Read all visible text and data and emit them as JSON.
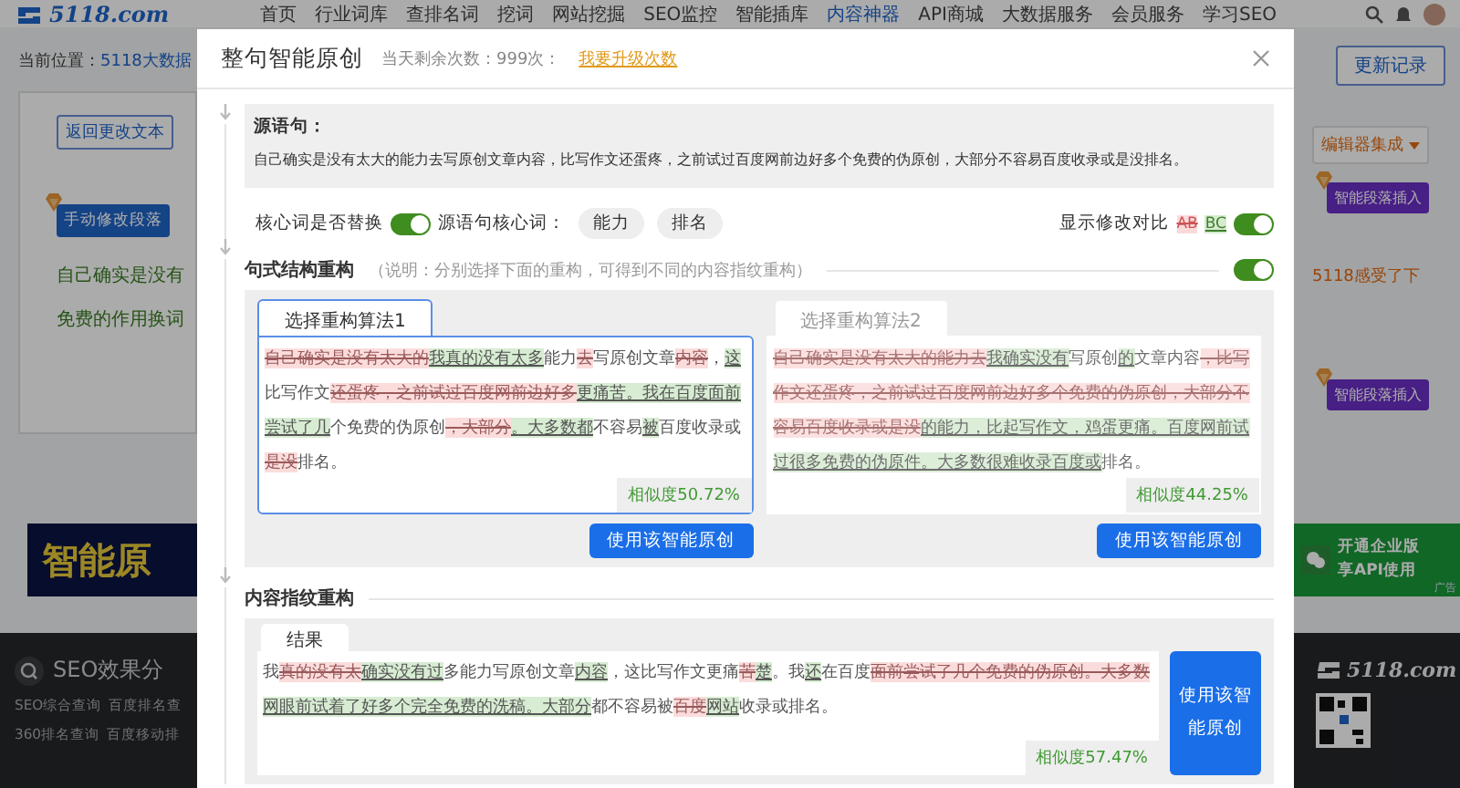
{
  "nav": {
    "logo": "5118.com",
    "items": [
      "首页",
      "行业词库",
      "查排名词",
      "挖词",
      "网站挖掘",
      "SEO监控",
      "智能插库",
      "内容神器",
      "API商城",
      "大数据服务",
      "会员服务",
      "学习SEO"
    ]
  },
  "background": {
    "breadcrumb_label": "当前位置：",
    "breadcrumb_link": "5118大数据",
    "back_button": "返回更改文本",
    "manual_button": "手动修改段落",
    "preview_lines": [
      "自己确实是没有",
      "免费的作用换词"
    ],
    "banner_left": "智能原",
    "footer_title": "SEO效果分",
    "footer_links": [
      "SEO综合查询",
      "百度排名查",
      "360排名查询",
      "百度移动排"
    ],
    "update_button": "更新记录",
    "editor_button": "编辑器集成",
    "insert_buttons": [
      "智能段落插入",
      "智能段落插入"
    ],
    "right_preview": "5118感受了下",
    "banner_right": [
      "开通企业版",
      "享API使用"
    ],
    "ad_label": "广告",
    "footer_logo": "5118.com"
  },
  "modal": {
    "title": "整句智能原创",
    "quota": "当天剩余次数：999次：",
    "upgrade_link": "我要升级次数",
    "source": {
      "heading": "源语句：",
      "text": "自己确实是没有太大的能力去写原创文章内容，比写作文还蛋疼，之前试过百度网前边好多个免费的伪原创，大部分不容易百度收录或是没排名。"
    },
    "options": {
      "replace_label": "核心词是否替换",
      "replace_on": true,
      "keywords_label": "源语句核心词：",
      "keywords": [
        "能力",
        "排名"
      ],
      "compare_label": "显示修改对比",
      "compare_removed": "AB",
      "compare_added": "BC",
      "compare_on": true
    },
    "restructure": {
      "title": "句式结构重构",
      "note": "（说明：分别选择下面的重构，可得到不同的内容指纹重构）",
      "on": true,
      "methods": [
        {
          "tab": "选择重构算法1",
          "selected": true,
          "similarity": "相似度50.72%",
          "button": "使用该智能原创",
          "segments": [
            {
              "kind": "del",
              "text": "自己确实是没有太大的"
            },
            {
              "kind": "ins",
              "text": "我真的没有太多"
            },
            {
              "kind": "plain",
              "text": "能力"
            },
            {
              "kind": "del",
              "text": "去"
            },
            {
              "kind": "plain",
              "text": "写原创文章"
            },
            {
              "kind": "del",
              "text": "内容"
            },
            {
              "kind": "plain",
              "text": "，"
            },
            {
              "kind": "ins",
              "text": "这"
            },
            {
              "kind": "plain",
              "text": "比写作文"
            },
            {
              "kind": "del",
              "text": "还蛋疼，之前试过百度网前边好多"
            },
            {
              "kind": "ins",
              "text": "更痛苦。我在百度面前尝试了几"
            },
            {
              "kind": "plain",
              "text": "个免费的伪原创"
            },
            {
              "kind": "del",
              "text": "，大部分"
            },
            {
              "kind": "ins",
              "text": "。大多数都"
            },
            {
              "kind": "plain",
              "text": "不容易"
            },
            {
              "kind": "ins",
              "text": "被"
            },
            {
              "kind": "plain",
              "text": "百度收录或"
            },
            {
              "kind": "del",
              "text": "是没"
            },
            {
              "kind": "plain",
              "text": "排名。"
            }
          ]
        },
        {
          "tab": "选择重构算法2",
          "selected": false,
          "similarity": "相似度44.25%",
          "button": "使用该智能原创",
          "segments": [
            {
              "kind": "del",
              "text": "自己确实是没有太大的能力去"
            },
            {
              "kind": "ins",
              "text": "我确实没有"
            },
            {
              "kind": "plain",
              "text": "写原创"
            },
            {
              "kind": "ins",
              "text": "的"
            },
            {
              "kind": "plain",
              "text": "文章内容"
            },
            {
              "kind": "del",
              "text": "，比写作文还蛋疼，之前试过百度网前边好多个免费的伪原创，大部分不容易百度收录或是没"
            },
            {
              "kind": "ins",
              "text": "的能力，比起写作文，鸡蛋更痛。百度网前试过很多免费的伪原件。大多数很难收录百度或"
            },
            {
              "kind": "plain",
              "text": "排名。"
            }
          ]
        }
      ]
    },
    "fingerprint": {
      "title": "内容指纹重构",
      "tab": "结果",
      "similarity": "相似度57.47%",
      "button": "使用该智能原创",
      "segments": [
        {
          "kind": "plain",
          "text": "我"
        },
        {
          "kind": "del",
          "text": "真的没有太"
        },
        {
          "kind": "ins",
          "text": "确实没有过"
        },
        {
          "kind": "plain",
          "text": "多能力写原创文章"
        },
        {
          "kind": "ins",
          "text": "内容"
        },
        {
          "kind": "plain",
          "text": "，这比写作文更痛"
        },
        {
          "kind": "del",
          "text": "苦"
        },
        {
          "kind": "ins",
          "text": "楚"
        },
        {
          "kind": "plain",
          "text": "。我"
        },
        {
          "kind": "ins",
          "text": "还"
        },
        {
          "kind": "plain",
          "text": "在百度"
        },
        {
          "kind": "del",
          "text": "面前尝试了几个免费的伪原创。大多数"
        },
        {
          "kind": "ins",
          "text": "网眼前试着了好多个完全免费的洗稿。大部分"
        },
        {
          "kind": "plain",
          "text": "都不容易被"
        },
        {
          "kind": "del",
          "text": "百度"
        },
        {
          "kind": "ins",
          "text": "网站"
        },
        {
          "kind": "plain",
          "text": "收录或排名。"
        }
      ]
    }
  }
}
